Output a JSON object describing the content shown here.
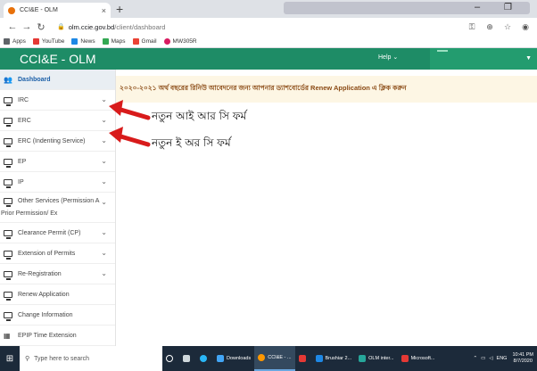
{
  "browser": {
    "tab_title": "CCI&E - OLM",
    "tab_close": "×",
    "new_tab": "+",
    "url_host": "olm.ccie.gov.bd",
    "url_path": "/client/dashboard",
    "minimize": "–",
    "maximize": "❐",
    "bookmarks": [
      {
        "label": "Apps",
        "color": "#5f6368"
      },
      {
        "label": "YouTube",
        "color": "#e53935"
      },
      {
        "label": "News",
        "color": "#1e88e5"
      },
      {
        "label": "Maps",
        "color": "#34a853"
      },
      {
        "label": "Gmail",
        "color": "#ea4335"
      },
      {
        "label": "MW305R",
        "color": "#d81b60"
      }
    ]
  },
  "app": {
    "brand": "CCI&E - OLM",
    "help_label": "Help ⌄",
    "user_caret": "▼",
    "accent": "#1e8c66"
  },
  "sidebar": {
    "items": [
      {
        "label": "Dashboard",
        "chevron": ""
      },
      {
        "label": "IRC",
        "chevron": "⌄"
      },
      {
        "label": "ERC",
        "chevron": "⌄"
      },
      {
        "label": "ERC (Indenting Service)",
        "chevron": "⌄"
      },
      {
        "label": "EP",
        "chevron": "⌄"
      },
      {
        "label": "IP",
        "chevron": "⌄"
      },
      {
        "label": "Other Services (Permission A",
        "label2": "Prior Permission/ Ex",
        "chevron": "⌄"
      },
      {
        "label": "Clearance Permit (CP)",
        "chevron": "⌄"
      },
      {
        "label": "Extension of Permits",
        "chevron": "⌄"
      },
      {
        "label": "Re-Registration",
        "chevron": "⌄"
      },
      {
        "label": "Renew Application",
        "chevron": ""
      },
      {
        "label": "Change Information",
        "chevron": ""
      },
      {
        "label": "EPIP Time Extension",
        "chevron": ""
      }
    ]
  },
  "main": {
    "notice": "২০২০-২০২১ অর্থ বছরের রিনিউ আবেদনের জন্য আপনার ড্যাশবোর্ডের Renew Application এ ক্লিক করুন",
    "callout_irc": "নতুন আই আর সি ফর্ম",
    "callout_erc": "নতুন ই অর সি ফর্ম"
  },
  "taskbar": {
    "search_placeholder": "Type here to search",
    "items": [
      {
        "label": "",
        "color": "#ffffff"
      },
      {
        "label": "",
        "color": "#cfd8dc"
      },
      {
        "label": "",
        "color": "#29b6f6"
      },
      {
        "label": "Downloads",
        "color": "#42a5f5"
      },
      {
        "label": "CCI&E - ...",
        "color": "#ff9800",
        "active": true
      },
      {
        "label": "",
        "color": "#e53935"
      },
      {
        "label": "Brushiar 2...",
        "color": "#1e88e5"
      },
      {
        "label": "OLM inter...",
        "color": "#26a69a"
      },
      {
        "label": "Microsoft...",
        "color": "#e53935"
      }
    ],
    "lang": "ENG",
    "time": "10:41 PM",
    "date": "8/7/2020"
  }
}
